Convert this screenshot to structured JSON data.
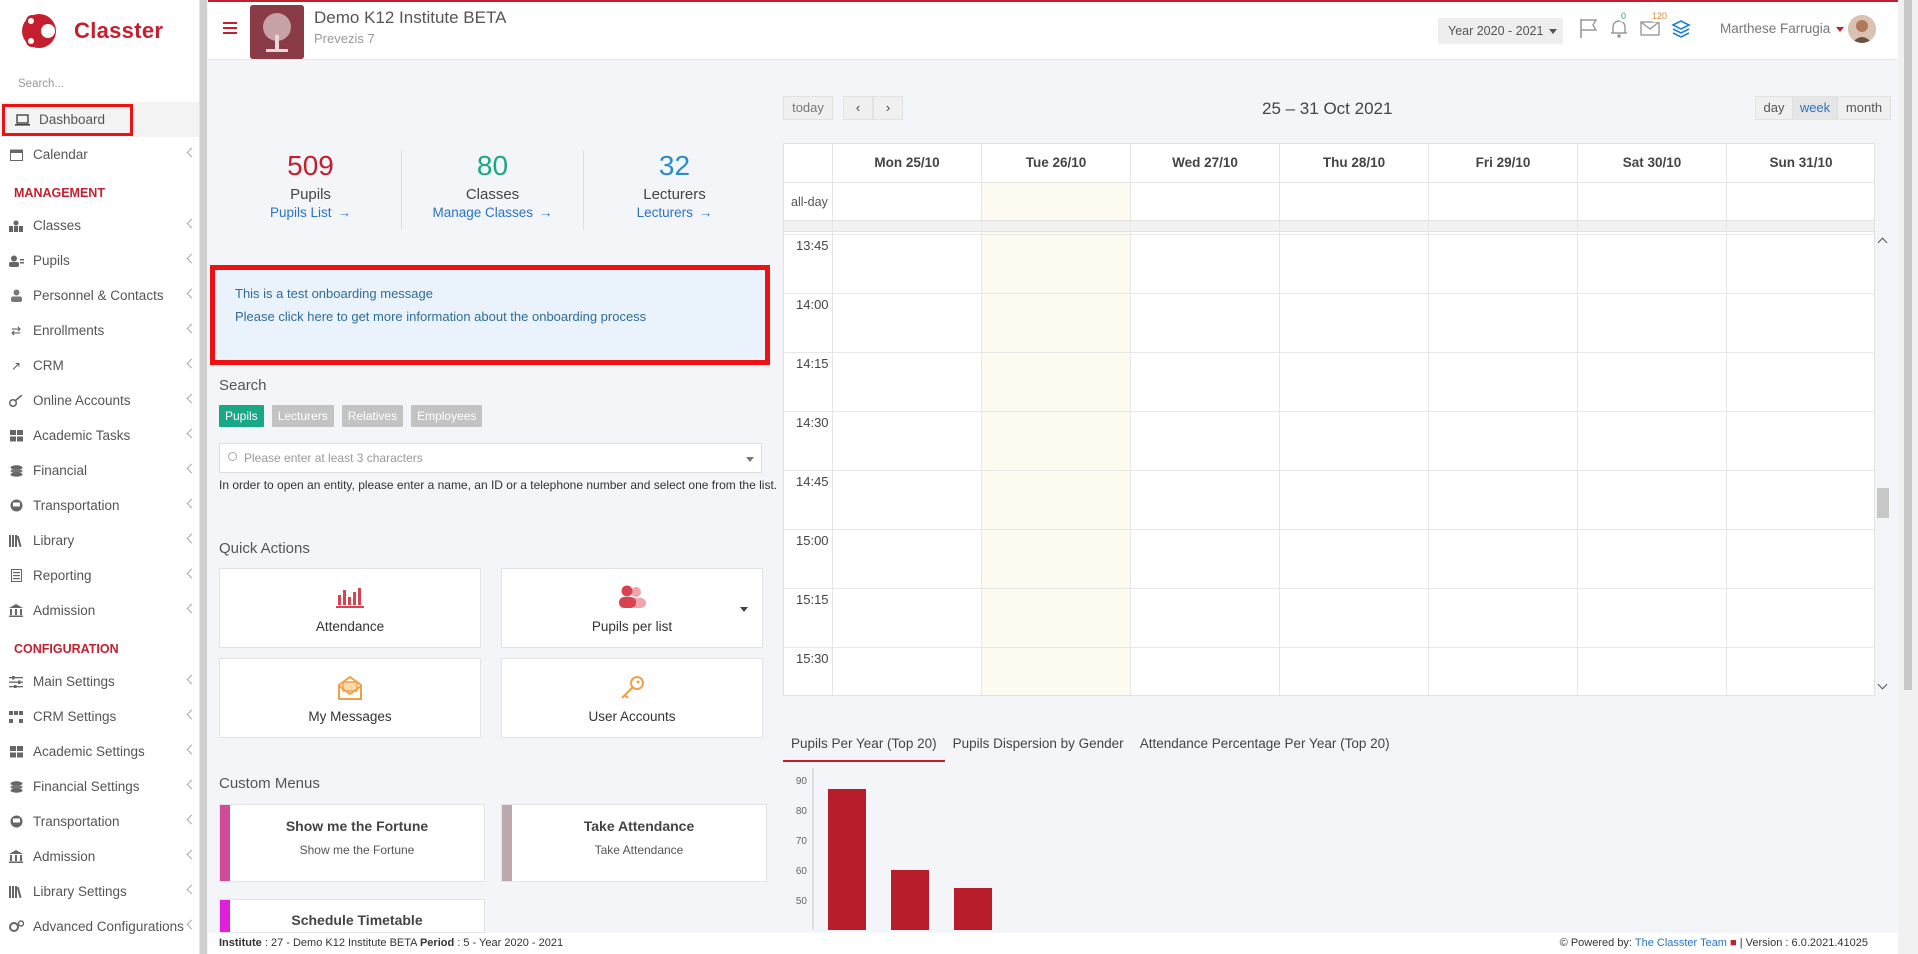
{
  "app": {
    "name": "Classter"
  },
  "sidebar": {
    "search_placeholder": "Search...",
    "items_top": [
      {
        "label": "Dashboard",
        "icon": "laptop-icon"
      },
      {
        "label": "Calendar",
        "icon": "calendar-icon"
      }
    ],
    "management_title": "MANAGEMENT",
    "management": [
      {
        "label": "Classes",
        "icon": "classes-icon"
      },
      {
        "label": "Pupils",
        "icon": "pupils-icon"
      },
      {
        "label": "Personnel & Contacts",
        "icon": "personnel-icon"
      },
      {
        "label": "Enrollments",
        "icon": "enrollments-icon"
      },
      {
        "label": "CRM",
        "icon": "crm-icon"
      },
      {
        "label": "Online Accounts",
        "icon": "key-icon"
      },
      {
        "label": "Academic Tasks",
        "icon": "tasks-icon"
      },
      {
        "label": "Financial",
        "icon": "coins-icon"
      },
      {
        "label": "Transportation",
        "icon": "bus-icon"
      },
      {
        "label": "Library",
        "icon": "library-icon"
      },
      {
        "label": "Reporting",
        "icon": "report-icon"
      },
      {
        "label": "Admission",
        "icon": "bank-icon"
      }
    ],
    "configuration_title": "CONFIGURATION",
    "configuration": [
      {
        "label": "Main Settings",
        "icon": "sliders-icon"
      },
      {
        "label": "CRM Settings",
        "icon": "crm-settings-icon"
      },
      {
        "label": "Academic Settings",
        "icon": "academic-settings-icon"
      },
      {
        "label": "Financial Settings",
        "icon": "coins-icon"
      },
      {
        "label": "Transportation",
        "icon": "bus-icon"
      },
      {
        "label": "Admission",
        "icon": "bank-icon"
      },
      {
        "label": "Library Settings",
        "icon": "library-icon"
      },
      {
        "label": "Advanced Configurations",
        "icon": "gears-icon"
      }
    ]
  },
  "topbar": {
    "institute": "Demo K12 Institute BETA",
    "subtitle": "Prevezis 7",
    "year": "Year 2020 - 2021",
    "notifications_count": "0",
    "messages_count": "120",
    "user": "Marthese Farrugia"
  },
  "stats": [
    {
      "value": "509",
      "label": "Pupils",
      "link": "Pupils List",
      "color": "#c41f2e"
    },
    {
      "value": "80",
      "label": "Classes",
      "link": "Manage Classes",
      "color": "#19a886"
    },
    {
      "value": "32",
      "label": "Lecturers",
      "link": "Lecturers",
      "color": "#2a8cc8"
    }
  ],
  "onboarding": {
    "line1": "This is a test onboarding message",
    "line2": "Please click here to get more information about the onboarding process"
  },
  "search": {
    "title": "Search",
    "tabs": [
      "Pupils",
      "Lecturers",
      "Relatives",
      "Employees"
    ],
    "placeholder": "Please enter at least 3 characters",
    "help": "In order to open an entity, please enter a name, an ID or a telephone number and select one from the list."
  },
  "quick_actions": {
    "title": "Quick Actions",
    "items": [
      "Attendance",
      "Pupils per list",
      "My Messages",
      "User Accounts"
    ]
  },
  "custom_menus": {
    "title": "Custom Menus",
    "items": [
      {
        "title": "Show me the Fortune",
        "subtitle": "Show me the Fortune",
        "color": "#d14b9a"
      },
      {
        "title": "Take Attendance",
        "subtitle": "Take Attendance",
        "color": "#bca9ae"
      },
      {
        "title": "Schedule Timetable",
        "subtitle": "",
        "color": "#e020d8"
      }
    ]
  },
  "calendar": {
    "today": "today",
    "range": "25 – 31 Oct 2021",
    "views": [
      "day",
      "week",
      "month"
    ],
    "days": [
      "Mon 25/10",
      "Tue 26/10",
      "Wed 27/10",
      "Thu 28/10",
      "Fri 29/10",
      "Sat 30/10",
      "Sun 31/10"
    ],
    "all_day": "all-day",
    "times": [
      "13:45",
      "14:00",
      "14:15",
      "14:30",
      "14:45",
      "15:00",
      "15:15",
      "15:30"
    ]
  },
  "chart_tabs": [
    "Pupils Per Year (Top 20)",
    "Pupils Dispersion by Gender",
    "Attendance Percentage Per Year (Top 20)"
  ],
  "chart_data": {
    "type": "bar",
    "values": [
      87,
      60,
      54
    ],
    "ylim": [
      40,
      94
    ],
    "yticks": [
      50,
      60,
      70,
      80,
      90
    ],
    "color": "#b81d2c"
  },
  "footer": {
    "institute_label": "Institute",
    "institute_value": ": 27 - Demo K12 Institute BETA",
    "period_label": "Period",
    "period_value": ": 5 - Year 2020 - 2021",
    "powered": "Powered by:",
    "team": "The Classter Team",
    "version": "| Version : 6.0.2021.41025"
  }
}
